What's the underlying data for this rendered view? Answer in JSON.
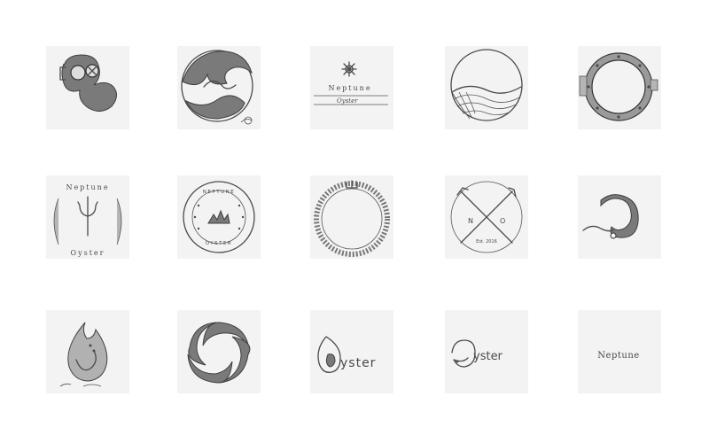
{
  "sheet": {
    "tiles": [
      {
        "name": "diving-helmet-sketch"
      },
      {
        "name": "wave-circle-sketch"
      },
      {
        "name": "neptune-oyster-wordmark-sketch",
        "brand": "Neptune",
        "sub": "Oyster"
      },
      {
        "name": "sea-waves-circle-sketch"
      },
      {
        "name": "porthole-sketch"
      },
      {
        "name": "trident-laurel-sketch",
        "brand": "Neptune",
        "sub": "Oyster"
      },
      {
        "name": "neptune-badge-sketch",
        "brand": "NEPTUNE",
        "sub": "OYSTER"
      },
      {
        "name": "rope-ring-sketch"
      },
      {
        "name": "crossed-tridents-sketch",
        "left": "N",
        "right": "O",
        "est": "Est. 2016"
      },
      {
        "name": "oyster-curl-sketch"
      },
      {
        "name": "drop-tentacle-sketch"
      },
      {
        "name": "swirl-circle-sketch"
      },
      {
        "name": "oyster-wordmark-sketch",
        "word": "yster"
      },
      {
        "name": "oyster-script-wordmark-sketch",
        "word": "yster"
      },
      {
        "name": "neptune-wordmark-sketch",
        "word": "Neptune"
      }
    ]
  }
}
